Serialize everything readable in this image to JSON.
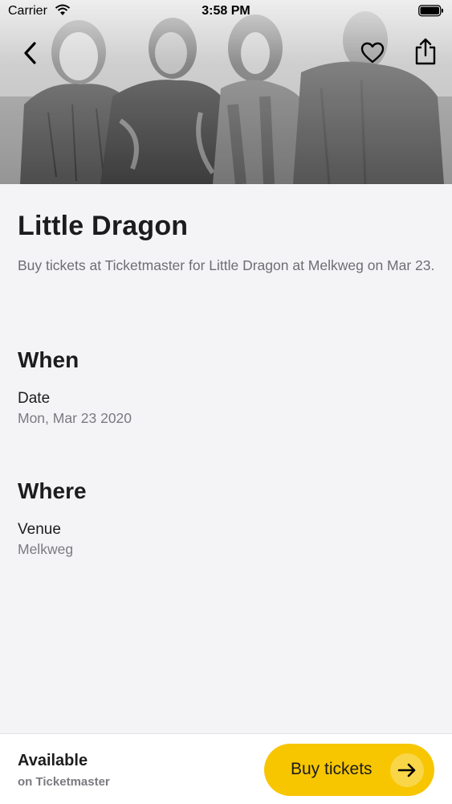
{
  "status_bar": {
    "carrier": "Carrier",
    "time": "3:58 PM"
  },
  "nav": {
    "back_icon": "chevron-left-icon",
    "favorite_icon": "heart-icon",
    "share_icon": "share-icon"
  },
  "event": {
    "title": "Little Dragon",
    "description": "Buy tickets at Ticketmaster for Little Dragon at Melkweg on Mar 23."
  },
  "when": {
    "heading": "When",
    "date_label": "Date",
    "date_value": "Mon, Mar 23 2020"
  },
  "where": {
    "heading": "Where",
    "venue_label": "Venue",
    "venue_value": "Melkweg"
  },
  "bottom_bar": {
    "availability": "Available",
    "provider": "on Ticketmaster",
    "buy_label": "Buy tickets",
    "buy_icon": "arrow-right-icon",
    "accent_color": "#f7c600"
  }
}
